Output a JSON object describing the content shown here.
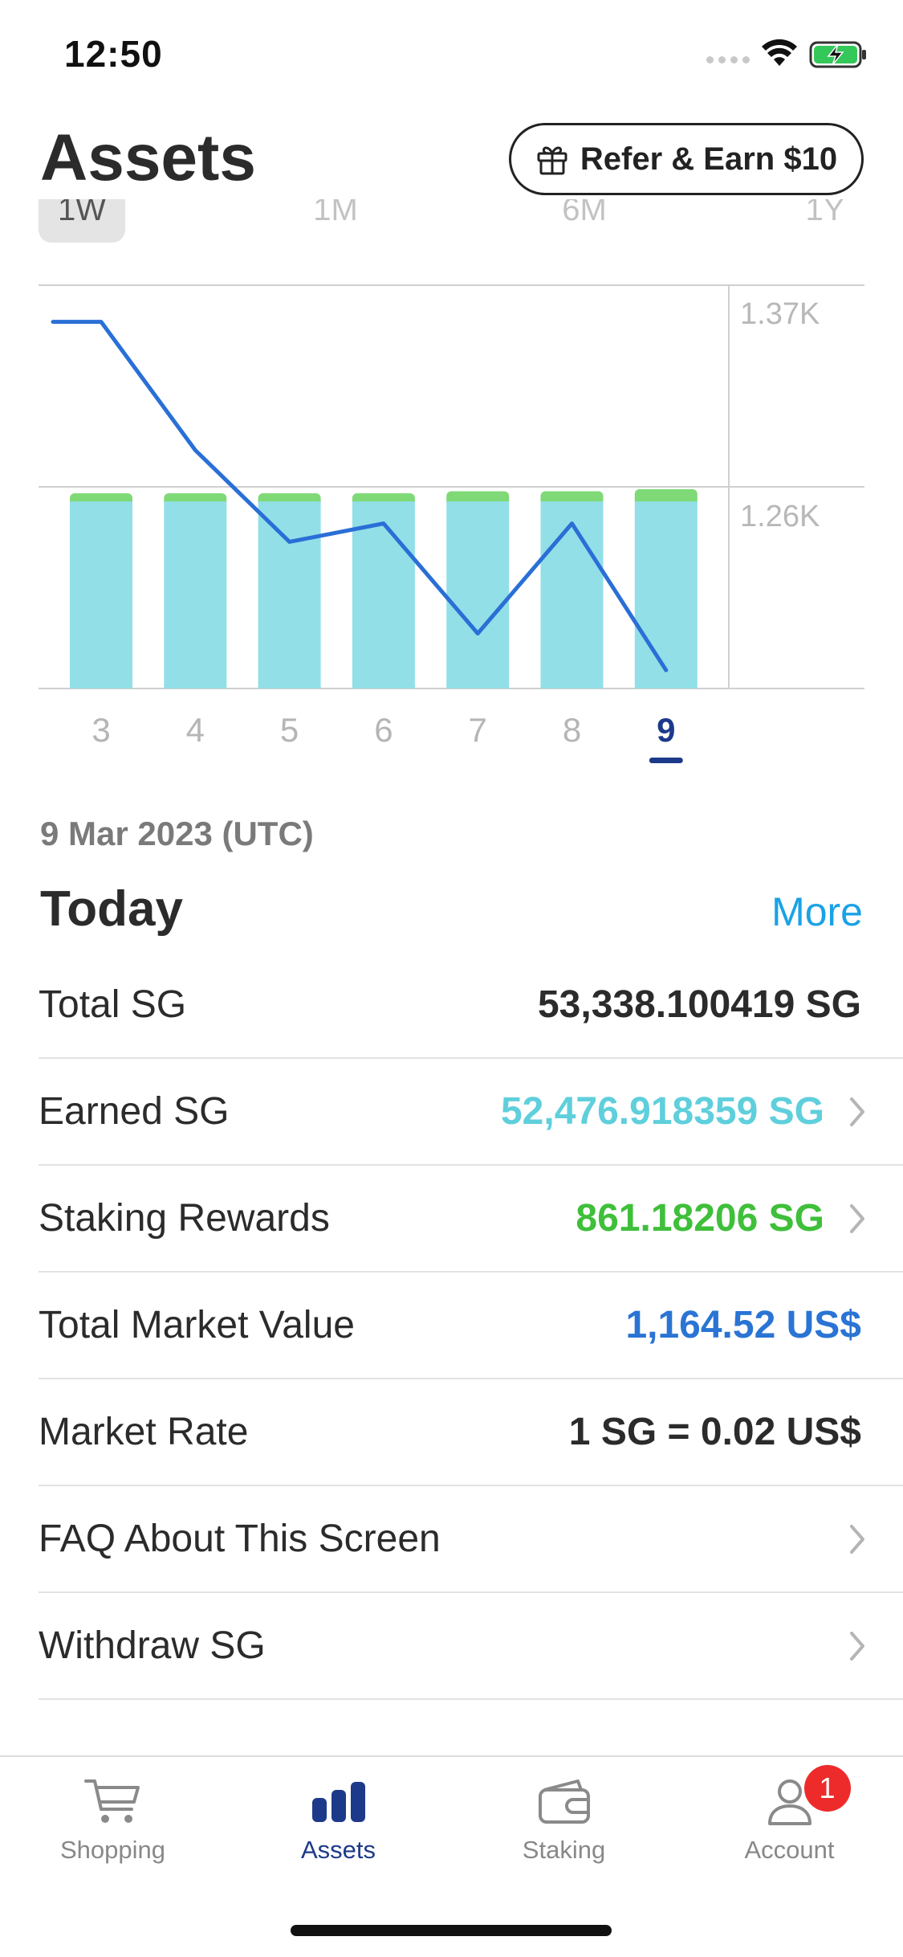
{
  "status_bar": {
    "time": "12:50"
  },
  "header": {
    "title": "Assets",
    "refer_label": "Refer & Earn $10"
  },
  "range_tabs": [
    {
      "label": "1W",
      "active": true
    },
    {
      "label": "1M",
      "active": false
    },
    {
      "label": "6M",
      "active": false
    },
    {
      "label": "1Y",
      "active": false
    }
  ],
  "chart_data": {
    "type": "bar",
    "categories": [
      "3",
      "4",
      "5",
      "6",
      "7",
      "8",
      "9"
    ],
    "selected_category": "9",
    "y_ticks": [
      "1.37K",
      "1.26K"
    ],
    "bar_series": [
      {
        "values": [
          0.91,
          0.91,
          0.91,
          0.91,
          0.91,
          0.91,
          0.91
        ],
        "color": "#92dfe8"
      },
      {
        "values": [
          0.04,
          0.04,
          0.04,
          0.04,
          0.05,
          0.05,
          0.06
        ],
        "color": "#7fd977"
      }
    ],
    "line_series": {
      "values": [
        1.35,
        1.35,
        1.28,
        1.23,
        1.24,
        1.18,
        1.24,
        1.16
      ],
      "x_positions": [
        2.5,
        3,
        4,
        5,
        6,
        7,
        8,
        9
      ],
      "color": "#2a6fd6"
    },
    "ylim": [
      1.15,
      1.37
    ],
    "grid": true
  },
  "summary": {
    "date": "9 Mar 2023 (UTC)",
    "title": "Today",
    "more": "More"
  },
  "rows": [
    {
      "label": "Total SG",
      "value": "53,338.100419 SG",
      "color": "#2b2b2b",
      "chevron": false
    },
    {
      "label": "Earned SG",
      "value": "52,476.918359 SG",
      "color": "#5fcfdc",
      "chevron": true
    },
    {
      "label": "Staking Rewards",
      "value": "861.18206 SG",
      "color": "#3fbf3a",
      "chevron": true
    },
    {
      "label": "Total Market Value",
      "value": "1,164.52 US$",
      "color": "#2a74d4",
      "chevron": false
    },
    {
      "label": "Market Rate",
      "value": "1 SG = 0.02 US$",
      "color": "#2b2b2b",
      "chevron": false
    },
    {
      "label": "FAQ About This Screen",
      "value": "",
      "color": "#2b2b2b",
      "chevron": true
    },
    {
      "label": "Withdraw SG",
      "value": "",
      "color": "#2b2b2b",
      "chevron": true
    }
  ],
  "tab_bar": [
    {
      "label": "Shopping",
      "icon": "cart-icon",
      "active": false
    },
    {
      "label": "Assets",
      "icon": "bar-chart-icon",
      "active": true
    },
    {
      "label": "Staking",
      "icon": "wallet-icon",
      "active": false
    },
    {
      "label": "Account",
      "icon": "person-icon",
      "active": false,
      "badge": "1"
    }
  ]
}
